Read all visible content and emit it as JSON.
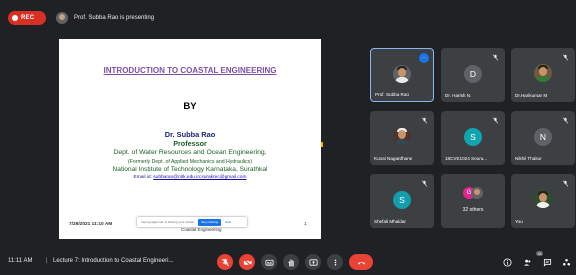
{
  "recording": {
    "label": "REC",
    "color": "#d93025"
  },
  "presenting_banner": {
    "text": "Prof. Subba Rao is presenting"
  },
  "slide": {
    "title": "INTRODUCTION TO COASTAL ENGINEERING",
    "by": "BY",
    "presenter_name": "Dr. Subba Rao",
    "presenter_role": "Professor",
    "department": "Dept. of Water Resources and Ocean Engineering,",
    "formerly": "(Formerly Dept. of Applied Mechanics and Hydraulics)",
    "institute": "National Institute of Technology Karnataka, Surathkal",
    "email_label": "Email id:",
    "email": "subbarao@nitk.edu.in;surakrec@gmail.com",
    "date": "7/29/2021 11:10 AM",
    "footer": "Coastal Engineering",
    "page_number": "1",
    "share_banner_text": "meet.google.com is sharing your screen",
    "share_stop_label": "Stop sharing",
    "share_hide_label": "Hide"
  },
  "participants": [
    {
      "name": "Prof. Subba Rao",
      "type": "photo",
      "active": true
    },
    {
      "name": "Dr. Harish N.",
      "type": "initial",
      "initial": "D",
      "color": "#5f6368",
      "muted": true
    },
    {
      "name": "Dr.Harikumar M",
      "type": "photo",
      "muted": true
    },
    {
      "name": "Kunal Nagardhane",
      "type": "photo",
      "muted": true
    },
    {
      "name": "18CVE1024 Soura...",
      "type": "initial",
      "initial": "S",
      "color": "#12a4af",
      "muted": true
    },
    {
      "name": "Nikhil Thakur",
      "type": "initial",
      "initial": "N",
      "color": "#5f6368",
      "muted": true
    },
    {
      "name": "Shefali Mhaldar",
      "type": "initial",
      "initial": "S",
      "color": "#129eaf",
      "muted": true
    },
    {
      "name": "32 others",
      "type": "group",
      "initial": "G"
    },
    {
      "name": "You",
      "type": "photo",
      "muted": true
    }
  ],
  "bottom_bar": {
    "time": "11:11 AM",
    "separator": "|",
    "meeting_title": "Lecture 7: Introduction to Coastal Engineeri...",
    "participant_count": "41"
  },
  "icons": {
    "mic": "mic-off-icon",
    "camera": "camera-off-icon",
    "captions": "captions-icon",
    "raise_hand": "raise-hand-icon",
    "present": "present-screen-icon",
    "more": "more-options-icon",
    "end_call": "end-call-icon",
    "info": "info-icon",
    "people": "people-icon",
    "chat": "chat-icon",
    "activities": "activities-icon"
  },
  "colors": {
    "background": "#202124",
    "tile": "#3c4043",
    "accent": "#1a73e8",
    "danger": "#ea4335"
  }
}
